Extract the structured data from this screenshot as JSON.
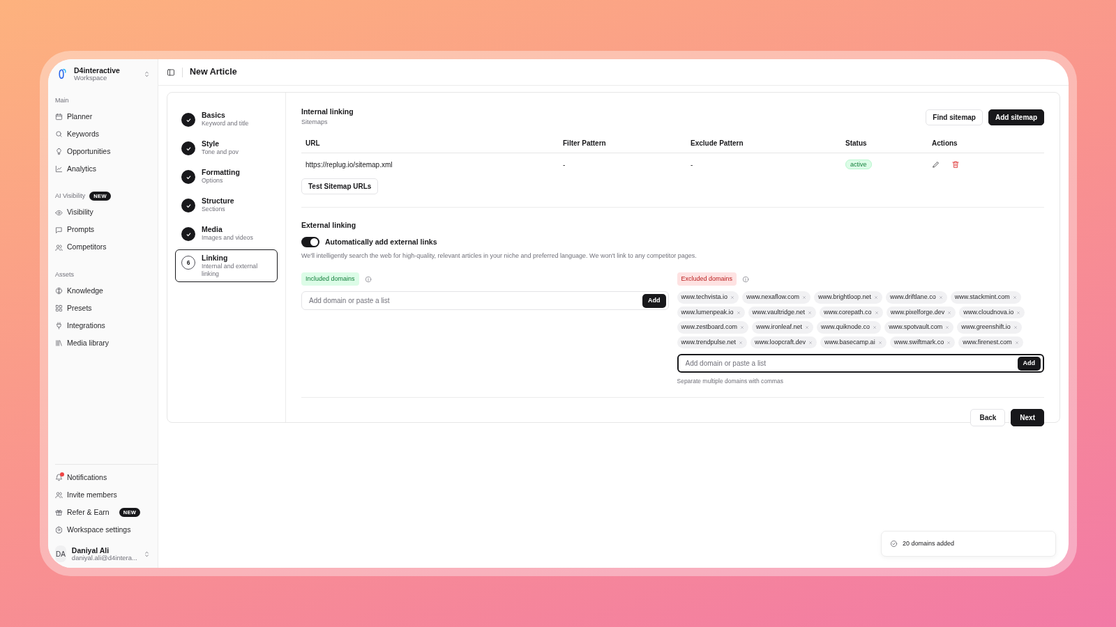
{
  "workspace": {
    "name": "D4interactive",
    "subtitle": "Workspace"
  },
  "sidebar": {
    "sections": [
      {
        "label": "Main",
        "items": [
          {
            "label": "Planner"
          },
          {
            "label": "Keywords"
          },
          {
            "label": "Opportunities"
          },
          {
            "label": "Analytics"
          }
        ]
      },
      {
        "label": "AI Visibility",
        "badge": "NEW",
        "items": [
          {
            "label": "Visibility"
          },
          {
            "label": "Prompts"
          },
          {
            "label": "Competitors"
          }
        ]
      },
      {
        "label": "Assets",
        "items": [
          {
            "label": "Knowledge"
          },
          {
            "label": "Presets"
          },
          {
            "label": "Integrations"
          },
          {
            "label": "Media library"
          }
        ]
      }
    ],
    "bottom_items": [
      {
        "label": "Notifications",
        "unread": true
      },
      {
        "label": "Invite members",
        "unread": false
      },
      {
        "label": "Refer & Earn",
        "unread": false,
        "badge": "NEW"
      },
      {
        "label": "Workspace settings",
        "unread": false
      }
    ],
    "user": {
      "initials": "DA",
      "name": "Daniyal Ali",
      "email": "daniyal.ali@d4intera..."
    }
  },
  "header": {
    "title": "New Article"
  },
  "steps": [
    {
      "title": "Basics",
      "subtitle": "Keyword and title",
      "done": true,
      "selected": false
    },
    {
      "title": "Style",
      "subtitle": "Tone and pov",
      "done": true,
      "selected": false
    },
    {
      "title": "Formatting",
      "subtitle": "Options",
      "done": true,
      "selected": false
    },
    {
      "title": "Structure",
      "subtitle": "Sections",
      "done": true,
      "selected": false
    },
    {
      "title": "Media",
      "subtitle": "Images and videos",
      "done": true,
      "selected": false
    },
    {
      "title": "Linking",
      "subtitle": "Internal and external linking",
      "number": "6",
      "done": false,
      "selected": true
    }
  ],
  "internal_linking": {
    "title": "Internal linking",
    "subtitle": "Sitemaps",
    "buttons": [
      {
        "label": "Find sitemap",
        "kind": "outline"
      },
      {
        "label": "Add sitemap",
        "kind": "dark"
      }
    ],
    "table": {
      "columns": [
        "URL",
        "Filter Pattern",
        "Exclude Pattern",
        "Status",
        "Actions"
      ],
      "rows": [
        {
          "url": "https://replug.io/sitemap.xml",
          "filter_pattern": "-",
          "exclude_pattern": "-",
          "status": "active"
        }
      ]
    },
    "test_button": "Test Sitemap URLs"
  },
  "external_linking": {
    "title": "External linking",
    "toggle": {
      "label": "Automatically add external links",
      "on": true
    },
    "description": "We'll intelligently search the web for high-quality, relevant articles in your niche and preferred language. We won't link to any competitor pages.",
    "included": {
      "label": "Included domains",
      "placeholder": "Add domain or paste a list",
      "add_button": "Add",
      "focused": false
    },
    "excluded": {
      "label": "Excluded domains",
      "tags": [
        "www.techvista.io",
        "www.nexaflow.com",
        "www.brightloop.net",
        "www.driftlane.co",
        "www.stackmint.com",
        "www.lumenpeak.io",
        "www.vaultridge.net",
        "www.corepath.co",
        "www.pixelforge.dev",
        "www.cloudnova.io",
        "www.zestboard.com",
        "www.ironleaf.net",
        "www.quiknode.co",
        "www.spotvault.com",
        "www.greenshift.io",
        "www.trendpulse.net",
        "www.loopcraft.dev",
        "www.basecamp.ai",
        "www.swiftmark.co",
        "www.firenest.com"
      ],
      "placeholder": "Add domain or paste a list",
      "add_button": "Add",
      "focused": true,
      "hint": "Separate multiple domains with commas"
    }
  },
  "footer_buttons": [
    {
      "label": "Back",
      "kind": "outline"
    },
    {
      "label": "Next",
      "kind": "dark"
    }
  ],
  "toast": {
    "text": "20 domains added"
  }
}
